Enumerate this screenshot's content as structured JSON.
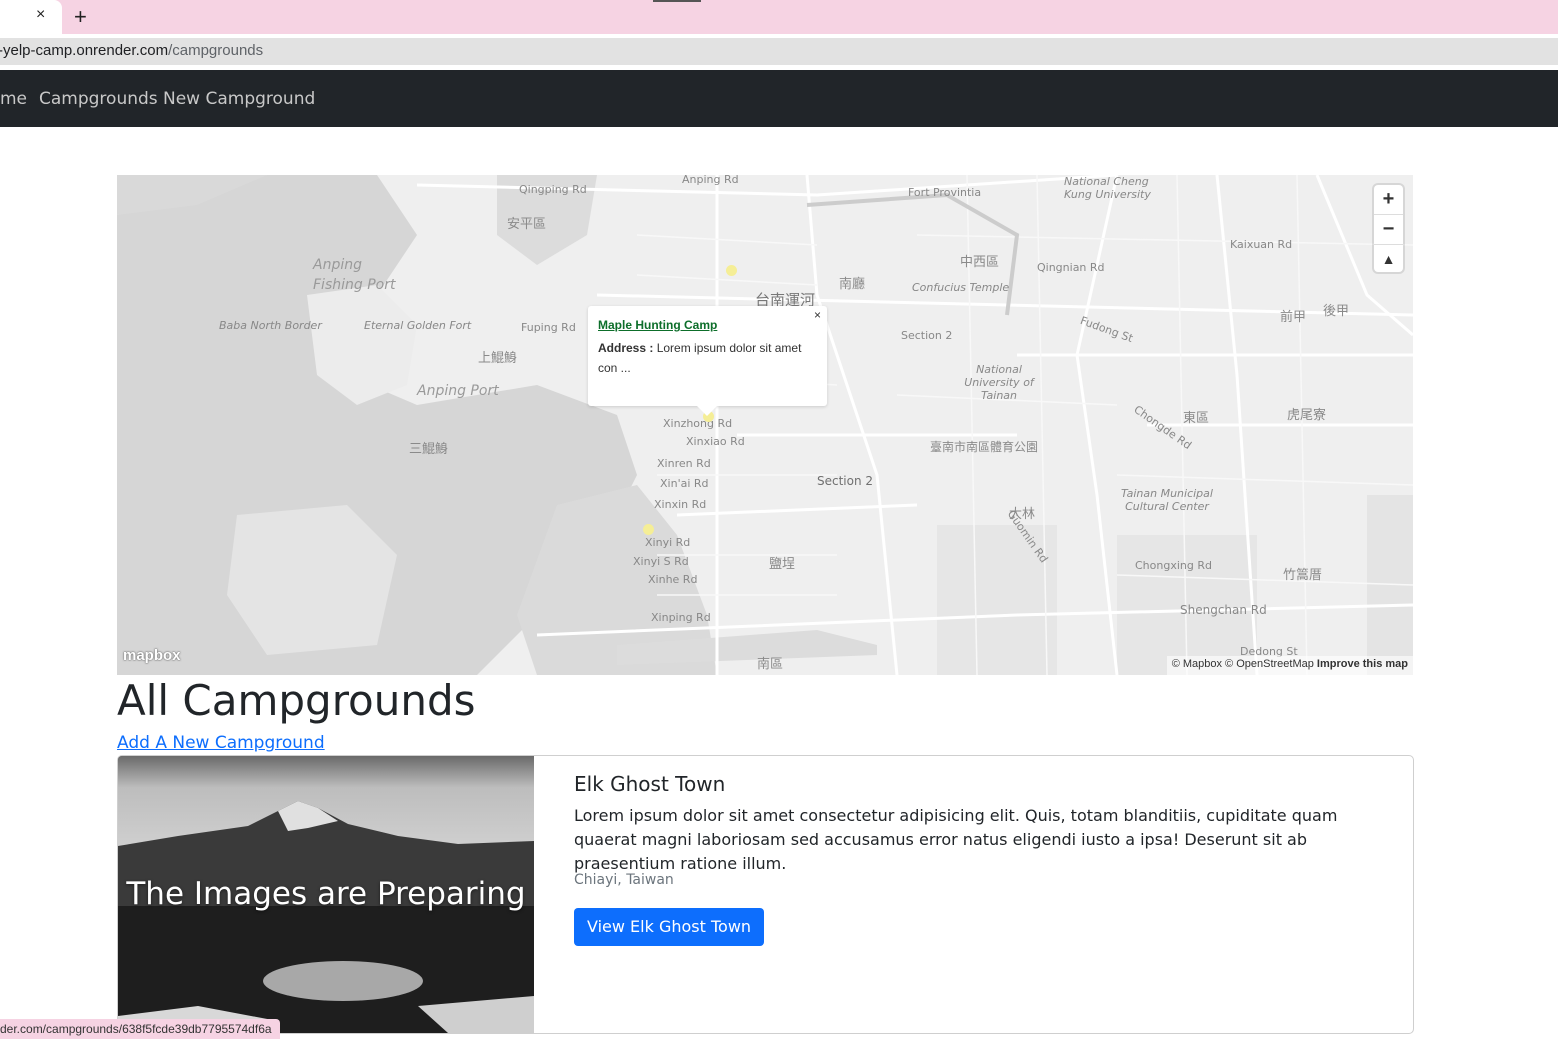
{
  "browser": {
    "tab_close": "×",
    "new_tab": "+",
    "url_host": "-yelp-camp.onrender.com",
    "url_path": "/campgrounds",
    "status_url": "der.com/campgrounds/638f5fcde39db7795574df6a"
  },
  "navbar": {
    "home": "me",
    "campgrounds": "Campgrounds",
    "new_campground": "New Campground"
  },
  "map": {
    "labels": {
      "anping_rd": "Anping Rd",
      "qingping_rd": "Qingping Rd",
      "fort_provintia": "Fort Provintia",
      "ncku": "National Cheng Kung University",
      "anping_fishing_port": "Anping Fishing Port",
      "anping_port": "Anping Port",
      "baba_north_border": "Baba North Border",
      "eternal_golden_fort": "Eternal Golden Fort",
      "fuping_rd": "Fuping Rd",
      "xinzhong_rd": "Xinzhong Rd",
      "xinxiao_rd": "Xinxiao Rd",
      "xinren_rd": "Xinren Rd",
      "xinai_rd": "Xin'ai Rd",
      "xinxin_rd": "Xinxin Rd",
      "xinyi_rd": "Xinyi Rd",
      "xinyi_s_rd": "Xinyi S Rd",
      "xinhe_rd": "Xinhe Rd",
      "xinping_rd": "Xinping Rd",
      "section_2": "Section 2",
      "section_2b": "Section 2",
      "confucius_temple": "Confucius Temple",
      "nutn": "National University of Tainan",
      "qingnian_rd": "Qingnian Rd",
      "kaixuan_rd": "Kaixuan Rd",
      "fudong_st": "Fudong St",
      "chongde_rd": "Chongde Rd",
      "tainan_cultural": "Tainan Municipal Cultural Center",
      "chongxing_rd": "Chongxing Rd",
      "shengchan_rd": "Shengchan Rd",
      "dedong_st": "Dedong St",
      "guomin_rd": "Guomin Rd",
      "cn_anping": "安平區",
      "cn_nanqu": "南區",
      "cn_zhongxi": "中西區",
      "cn_dongqu": "東區",
      "cn_canal": "台南運河",
      "cn_yancheng": "鹽埕",
      "cn_dalin": "大林",
      "cn_zhuxi": "竹篙厝",
      "cn_huwei": "虎尾寮",
      "cn_sankunshen": "三鯤鯓",
      "cn_shangkunshen": "上鯤鯓",
      "cn_qianjia": "前甲",
      "cn_houjia": "後甲",
      "cn_nanting": "南廳",
      "cn_sports": "臺南市南區體育公園"
    },
    "zoom_in": "+",
    "zoom_out": "−",
    "reset_north": "▲",
    "popup": {
      "close": "×",
      "title": "Maple Hunting Camp",
      "address_label": "Address :",
      "address_text": " Lorem ipsum dolor sit amet con ..."
    },
    "logo": "mapbox",
    "attribution": "© Mapbox © OpenStreetMap",
    "improve": "Improve this map",
    "marker_color": "#f5ee96"
  },
  "main": {
    "title": "All Campgrounds",
    "add_link": "Add A New Campground"
  },
  "campground_card": {
    "image_text": "The Images are Preparing",
    "title": "Elk Ghost Town",
    "description": "Lorem ipsum dolor sit amet consectetur adipisicing elit. Quis, totam blanditiis, cupiditate quam quaerat magni laboriosam sed accusamus error natus eligendi iusto a ipsa! Deserunt sit ab praesentium ratione illum.",
    "location": "Chiayi, Taiwan",
    "button": "View Elk Ghost Town",
    "button_color": "#0d6efd"
  }
}
